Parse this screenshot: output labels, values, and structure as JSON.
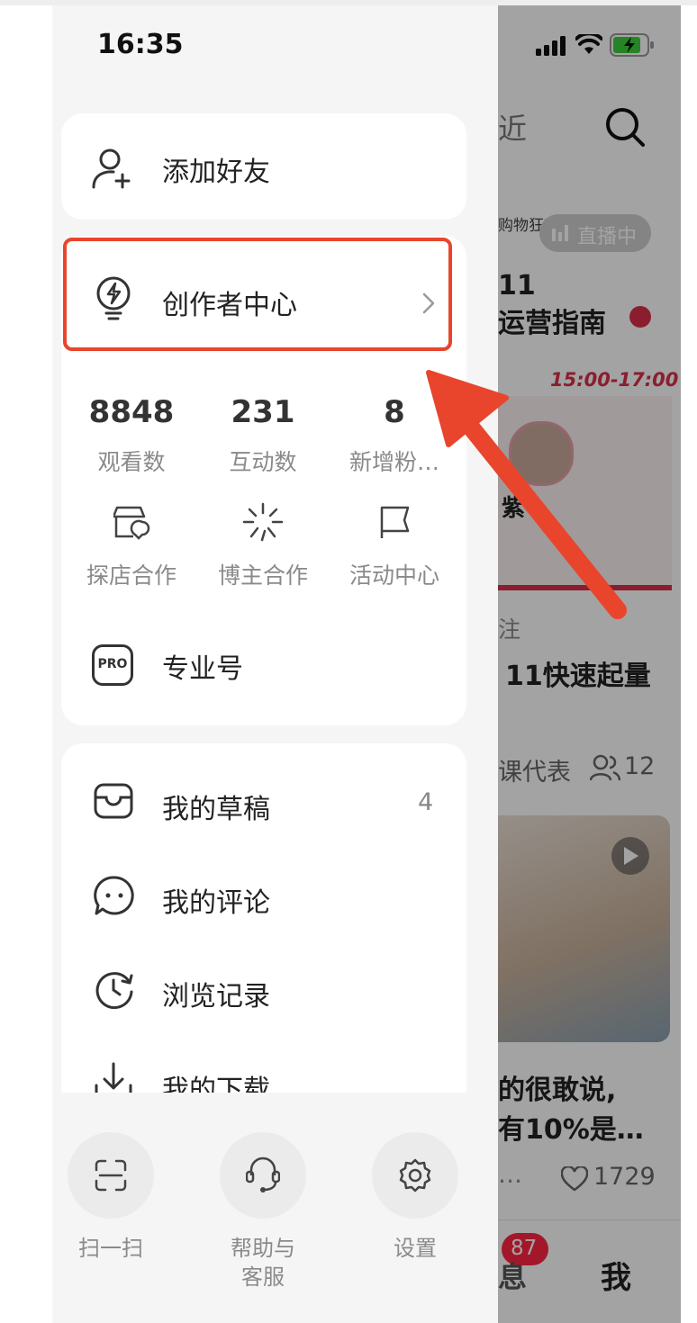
{
  "status_bar": {
    "time": "16:35"
  },
  "drawer": {
    "add_friend": {
      "label": "添加好友",
      "icon": "add-user-icon"
    },
    "creator_center": {
      "label": "创作者中心",
      "icon": "lightbulb-icon",
      "highlight_color": "#e8452c"
    },
    "stats": [
      {
        "value": "8848",
        "label": "观看数"
      },
      {
        "value": "231",
        "label": "互动数"
      },
      {
        "value": "8",
        "label": "新增粉…"
      }
    ],
    "tools": [
      {
        "label": "探店合作",
        "icon": "store-location-icon"
      },
      {
        "label": "博主合作",
        "icon": "sparkle-icon"
      },
      {
        "label": "活动中心",
        "icon": "flag-icon"
      }
    ],
    "pro": {
      "label": "专业号",
      "badge": "PRO"
    },
    "menu": [
      {
        "label": "我的草稿",
        "count": "4",
        "icon": "inbox-tray-icon"
      },
      {
        "label": "我的评论",
        "icon": "chat-bubble-icon"
      },
      {
        "label": "浏览记录",
        "icon": "history-clock-icon"
      },
      {
        "label": "我的下载",
        "icon": "download-icon"
      }
    ],
    "footer": [
      {
        "label": "扫一扫",
        "icon": "scan-icon"
      },
      {
        "label": "帮助与客服",
        "line1": "帮助与",
        "line2": "客服",
        "icon": "headset-icon"
      },
      {
        "label": "设置",
        "icon": "gear-icon"
      }
    ]
  },
  "background_app": {
    "header_tab_fragment": "近",
    "live_badge": "直播中",
    "promo_fragment": "购物狂欢",
    "title_line1": "11",
    "title_line2": "运营指南",
    "time_range": "15:00-17:00",
    "speaker_name": "紫",
    "post_category": "注",
    "post_title": "11快速起量",
    "author_fragment": "课代表",
    "people_count": "12",
    "post2_line1": "的很敢说,",
    "post2_line2": "有10%是…",
    "ellipsis": "…",
    "likes": "1729",
    "tab_badge": "87",
    "tab_message_fragment": "息",
    "tab_me": "我"
  },
  "colors": {
    "accent_red": "#e8452c",
    "badge_red": "#ff2442"
  }
}
